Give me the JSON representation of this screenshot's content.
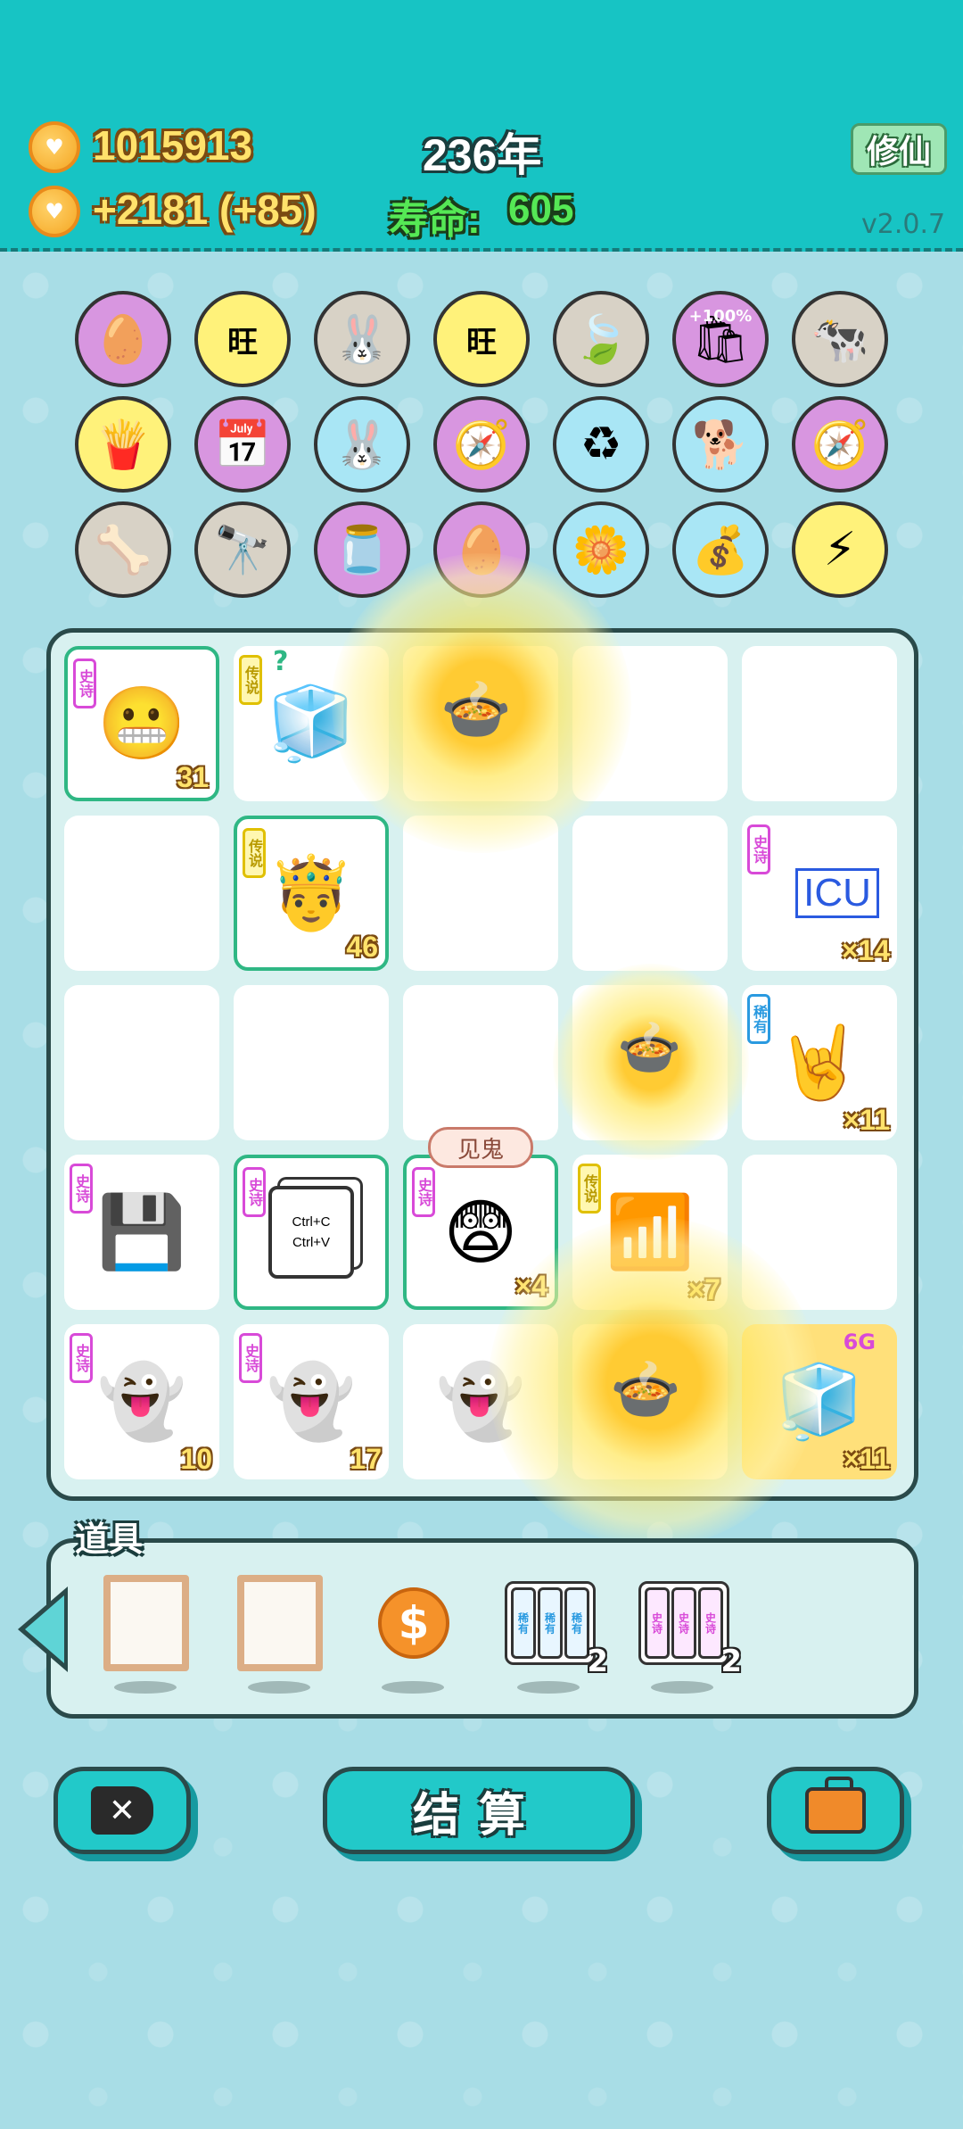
{
  "header": {
    "coins": "1015913",
    "income": "+2181 (+85)",
    "year": "236年",
    "lifespan_label": "寿命:",
    "lifespan_value": "605",
    "xiuxian_label": "修仙",
    "version": "v2.0.7"
  },
  "buffs": [
    {
      "icon": "egg-icon",
      "color": "purple"
    },
    {
      "icon": "wang-tiles-icon",
      "color": "yellow"
    },
    {
      "icon": "rabbit-icon",
      "color": "gray"
    },
    {
      "icon": "wang-tiles-icon",
      "color": "yellow"
    },
    {
      "icon": "leaf-icon",
      "color": "gray"
    },
    {
      "icon": "flour-bag-icon",
      "color": "purple",
      "text": "+100%"
    },
    {
      "icon": "cows-icon",
      "color": "gray"
    },
    {
      "icon": "fries-icon",
      "color": "yellow"
    },
    {
      "icon": "calendar-icon",
      "color": "purple"
    },
    {
      "icon": "rabbit-icon",
      "color": "blue"
    },
    {
      "icon": "compass-icon",
      "color": "purple"
    },
    {
      "icon": "trash-bag-icon",
      "color": "blue"
    },
    {
      "icon": "cool-dog-icon",
      "color": "blue"
    },
    {
      "icon": "compass-icon",
      "color": "purple"
    },
    {
      "icon": "pet-bowl-icon",
      "color": "gray"
    },
    {
      "icon": "binoculars-icon",
      "color": "gray"
    },
    {
      "icon": "jar-icon",
      "color": "purple"
    },
    {
      "icon": "egg-icon",
      "color": "purple"
    },
    {
      "icon": "flower-pot-icon",
      "color": "blue"
    },
    {
      "icon": "sack-icon",
      "color": "blue"
    },
    {
      "icon": "lightning-icon",
      "color": "yellow"
    }
  ],
  "board": {
    "ghost_bubble": "见鬼",
    "cells": [
      {
        "rarity": "史诗",
        "rclass": "r-epic",
        "icon": "face-man-icon",
        "count": "31",
        "framed": true
      },
      {
        "rarity": "传说",
        "rclass": "r-legend",
        "icon": "fridge-icon",
        "count": "",
        "framed": false
      },
      {
        "rarity": "",
        "rclass": "",
        "icon": "pressure-cooker-icon",
        "count": "",
        "framed": false
      },
      {
        "rarity": "",
        "rclass": "",
        "icon": "",
        "count": "",
        "framed": false
      },
      {
        "rarity": "",
        "rclass": "",
        "icon": "",
        "count": "",
        "framed": false
      },
      {
        "rarity": "",
        "rclass": "",
        "icon": "",
        "count": "",
        "framed": false
      },
      {
        "rarity": "传说",
        "rclass": "r-legend",
        "icon": "king-face-icon",
        "count": "46",
        "framed": true
      },
      {
        "rarity": "",
        "rclass": "",
        "icon": "",
        "count": "",
        "framed": false
      },
      {
        "rarity": "",
        "rclass": "",
        "icon": "",
        "count": "",
        "framed": false
      },
      {
        "rarity": "史诗",
        "rclass": "r-epic",
        "icon": "icu-sign-icon",
        "count": "×14",
        "framed": false
      },
      {
        "rarity": "",
        "rclass": "",
        "icon": "",
        "count": "",
        "framed": false
      },
      {
        "rarity": "",
        "rclass": "",
        "icon": "",
        "count": "",
        "framed": false
      },
      {
        "rarity": "",
        "rclass": "",
        "icon": "",
        "count": "",
        "framed": false
      },
      {
        "rarity": "",
        "rclass": "",
        "icon": "pressure-cooker-icon",
        "count": "",
        "framed": false
      },
      {
        "rarity": "稀有",
        "rclass": "r-rare",
        "icon": "rock-hand-icon",
        "count": "×11",
        "framed": false
      },
      {
        "rarity": "史诗",
        "rclass": "r-epic",
        "icon": "gpu-card-icon",
        "count": "",
        "framed": false
      },
      {
        "rarity": "史诗",
        "rclass": "r-epic",
        "icon": "copy-paste-icon",
        "count": "",
        "framed": true
      },
      {
        "rarity": "史诗",
        "rclass": "r-epic",
        "icon": "face-scared-icon",
        "count": "×4",
        "framed": true
      },
      {
        "rarity": "传说",
        "rclass": "r-legend",
        "icon": "wifi-icon",
        "count": "×7",
        "framed": false
      },
      {
        "rarity": "",
        "rclass": "",
        "icon": "",
        "count": "",
        "framed": false
      },
      {
        "rarity": "史诗",
        "rclass": "r-epic",
        "icon": "ghost-icon",
        "count": "10",
        "framed": false
      },
      {
        "rarity": "史诗",
        "rclass": "r-epic",
        "icon": "ghost-icon",
        "count": "17",
        "framed": false
      },
      {
        "rarity": "",
        "rclass": "",
        "icon": "ghost-coins-icon",
        "count": "",
        "framed": false
      },
      {
        "rarity": "",
        "rclass": "",
        "icon": "pressure-cooker-icon",
        "count": "",
        "framed": false
      },
      {
        "rarity": "",
        "rclass": "",
        "icon": "fridge-6g-icon",
        "count": "×11",
        "framed": false,
        "gold": true
      }
    ],
    "copy_text_1": "Ctrl+C",
    "copy_text_2": "Ctrl+V",
    "icu_text": "ICU",
    "fridge_badge": "6G",
    "question": "?"
  },
  "items": {
    "title": "道具",
    "list": [
      {
        "icon": "frame-icon"
      },
      {
        "icon": "frame-icon"
      },
      {
        "icon": "dollar-coin-icon",
        "symbol": "$"
      },
      {
        "icon": "triple-rare-card-icon",
        "label": "稀有",
        "count": "2"
      },
      {
        "icon": "triple-epic-card-icon",
        "label": "史诗",
        "count": "2"
      }
    ]
  },
  "buttons": {
    "close_symbol": "✕",
    "settle_label": "结算"
  },
  "colors": {
    "header_bg": "#17c4c4",
    "page_bg": "#a8dde6",
    "accent_gold": "#ffe26b",
    "life_green": "#55e855"
  }
}
